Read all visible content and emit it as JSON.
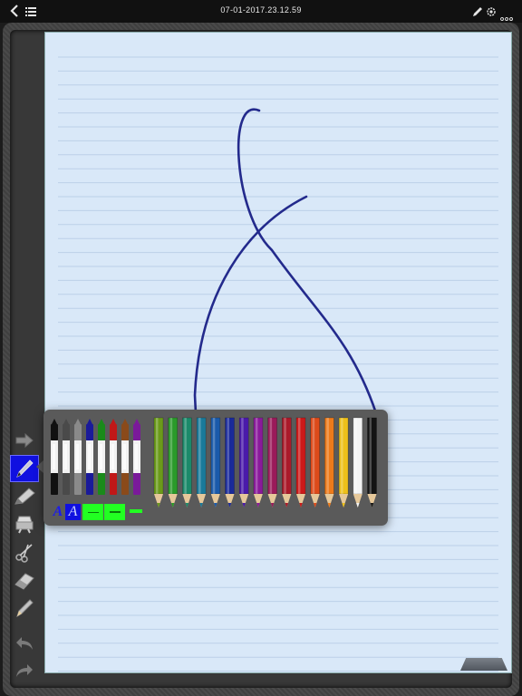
{
  "statusbar": {
    "title": "07-01-2017.23.12.59",
    "icons": [
      "chevron-left-icon",
      "list-icon",
      "pencil-icon",
      "gear-icon",
      "more-icon"
    ]
  },
  "toolbar": {
    "tools": [
      {
        "name": "arrow-right-icon",
        "selected": false
      },
      {
        "name": "pen-tool-icon",
        "selected": true
      },
      {
        "name": "highlighter-icon",
        "selected": false
      },
      {
        "name": "stamp-icon",
        "selected": false
      },
      {
        "name": "scissors-icon",
        "selected": false
      },
      {
        "name": "eraser-icon",
        "selected": false
      },
      {
        "name": "pencil-tool-icon",
        "selected": false
      },
      {
        "name": "undo-icon",
        "selected": false
      },
      {
        "name": "redo-icon",
        "selected": false
      }
    ]
  },
  "palette": {
    "pens": [
      {
        "color": "#111111",
        "name": "black"
      },
      {
        "color": "#4a4a4a",
        "name": "dark-gray"
      },
      {
        "color": "#8a8a8a",
        "name": "gray"
      },
      {
        "color": "#1a1a9a",
        "name": "navy"
      },
      {
        "color": "#1a8a1a",
        "name": "green"
      },
      {
        "color": "#c01818",
        "name": "red"
      },
      {
        "color": "#8a4a1a",
        "name": "brown"
      },
      {
        "color": "#7a1a9a",
        "name": "purple"
      }
    ],
    "pencils": [
      {
        "color": "#6a9a1a",
        "name": "yellow-green"
      },
      {
        "color": "#2a9a2a",
        "name": "green"
      },
      {
        "color": "#1a8a6a",
        "name": "teal-green"
      },
      {
        "color": "#1a7a9a",
        "name": "teal"
      },
      {
        "color": "#1a5aaa",
        "name": "blue"
      },
      {
        "color": "#1a2a9a",
        "name": "navy"
      },
      {
        "color": "#4a1aaa",
        "name": "indigo"
      },
      {
        "color": "#8a1a9a",
        "name": "violet"
      },
      {
        "color": "#9a1a5a",
        "name": "plum"
      },
      {
        "color": "#aa1a2a",
        "name": "crimson"
      },
      {
        "color": "#cc1a1a",
        "name": "red"
      },
      {
        "color": "#dd4a1a",
        "name": "red-orange"
      },
      {
        "color": "#ee7a1a",
        "name": "orange"
      },
      {
        "color": "#eec01a",
        "name": "yellow"
      },
      {
        "color": "#f4f4f4",
        "name": "white"
      },
      {
        "color": "#141414",
        "name": "black"
      }
    ],
    "style_buttons": [
      {
        "name": "font-style-plain-button",
        "glyph": "A",
        "selected": false
      },
      {
        "name": "font-style-italic-button",
        "glyph": "A",
        "selected": true
      },
      {
        "name": "line-thin-button",
        "selected": false
      },
      {
        "name": "line-medium-button",
        "selected": false
      },
      {
        "name": "line-thick-button",
        "selected": false
      }
    ],
    "accent_color": "#22ff22",
    "selected_color": "#1010e0"
  },
  "canvas": {
    "paper_color": "#d9e8f8",
    "rule_color": "#bcd0e8",
    "ink_color": "#232a8c"
  }
}
